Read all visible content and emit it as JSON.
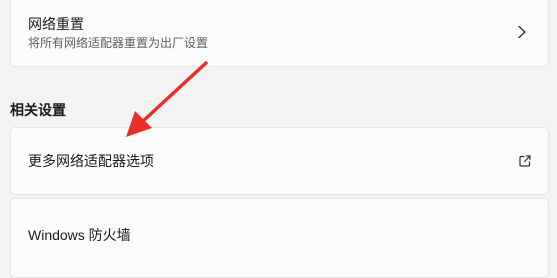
{
  "network_reset": {
    "title": "网络重置",
    "subtitle": "将所有网络适配器重置为出厂设置",
    "icon": "chevron-right-icon"
  },
  "related_settings": {
    "heading": "相关设置",
    "items": [
      {
        "label": "更多网络适配器选项",
        "icon": "external-link-icon"
      },
      {
        "label": "Windows 防火墙"
      }
    ]
  },
  "annotation": {
    "color": "#e8302a"
  }
}
